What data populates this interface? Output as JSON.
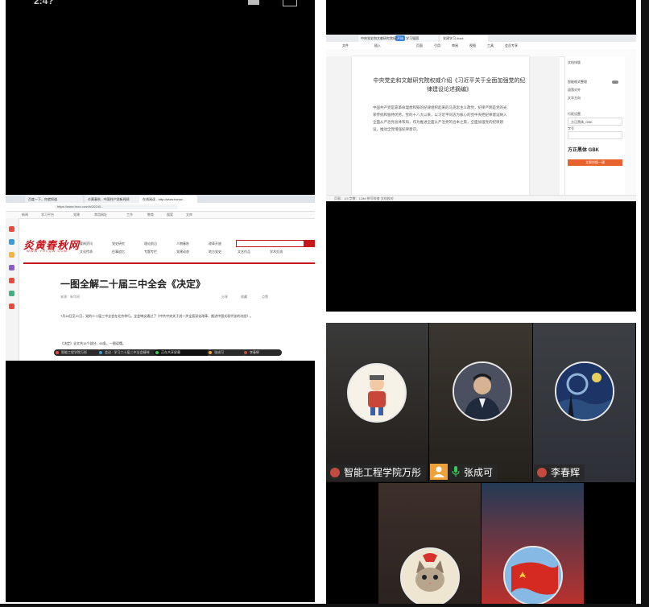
{
  "status_bar": {
    "time": "2:4?"
  },
  "browser": {
    "tabs": [
      "百度一下，你就知道",
      "炎黄春秋 - 中国共产党新闻网",
      "在线阅读 - http://www.hxrcw..."
    ],
    "url": "https://www.hxzc.com/b/20240...",
    "bookmarks": [
      "新闻",
      "学习平台",
      "党建",
      "常用网址",
      "工作",
      "教育",
      "搜索",
      "文库"
    ],
    "site_logo": "炎黄春秋网",
    "site_logo_sub": "WWW.YHCQW.COM",
    "nav": [
      "要闻资讯",
      "党史研究",
      "理论前沿",
      "人物春秋",
      "改革开放",
      "文化传承",
      "往事追忆",
      "专题专栏",
      "党建动态",
      "地方党史",
      "文艺作品",
      "学术交流"
    ],
    "article_title": "一图全解二十届三中全会《决定》",
    "meta": "来源：新华网",
    "actions": [
      "分享",
      "收藏",
      "点赞"
    ],
    "body_1": "7月18日至21日，党的二十届三中全会在北京举行。全会审议通过了《中共中央关于进一步全面深化改革、推进中国式现代化的决定》。",
    "body_2": "《决定》全文共15个部分、60条，一图读懂。",
    "taskbar": [
      "智能工程学院万彤",
      "会议 · 学习二十届三中全会精神",
      "正在共享屏幕",
      "张成可",
      "李春辉"
    ]
  },
  "document": {
    "tabs": [
      "中央党史和文献研究院权威介绍",
      "学习强国",
      "党建学习.docx"
    ],
    "menu": [
      "文件",
      "开始",
      "插入",
      "页面",
      "引用",
      "审阅",
      "视图",
      "工具",
      "会员专享"
    ],
    "start_label": "开始",
    "title": "中央党史和文献研究院权威介绍《习近平关于全面加强党的纪律建设论述摘编》",
    "body": "中国共产党是靠革命理想和铁的纪律组织起来的马克思主义政党，纪律严明是党的光荣传统和独特优势。党的十八大以来，以习近平同志为核心的党中央把纪律建设纳入全面从严治党总体布局，作为推进全面从严治党的治本之策，全面加强党的纪律建设，推动全党增强纪律意识。",
    "panel": [
      "文档排版",
      "智能格式整理",
      "段落对齐",
      "文字方向",
      "行距设置",
      "字号",
      "方正黑体 GBK",
      "一键排版"
    ],
    "panel_font": "方正黑体_GBK",
    "panel_button": "立即排版一键",
    "status": "页面：1/3  字数：1286  拼写检查  文档校对"
  },
  "participants": [
    {
      "name": "智能工程学院万彤",
      "avatar_icon": "cartoon-person-icon"
    },
    {
      "name": "张成可",
      "avatar_icon": "person-photo-icon",
      "is_host": true,
      "mic_on": true
    },
    {
      "name": "李春辉",
      "avatar_icon": "starry-night-icon"
    },
    {
      "name": "",
      "avatar_icon": "cat-icon"
    },
    {
      "name": "",
      "avatar_icon": "flag-icon"
    }
  ],
  "colors": {
    "accent_red": "#c8161d",
    "host_orange": "#f0a23a",
    "mic_green": "#34c759",
    "doc_blue": "#3a7bd5"
  }
}
